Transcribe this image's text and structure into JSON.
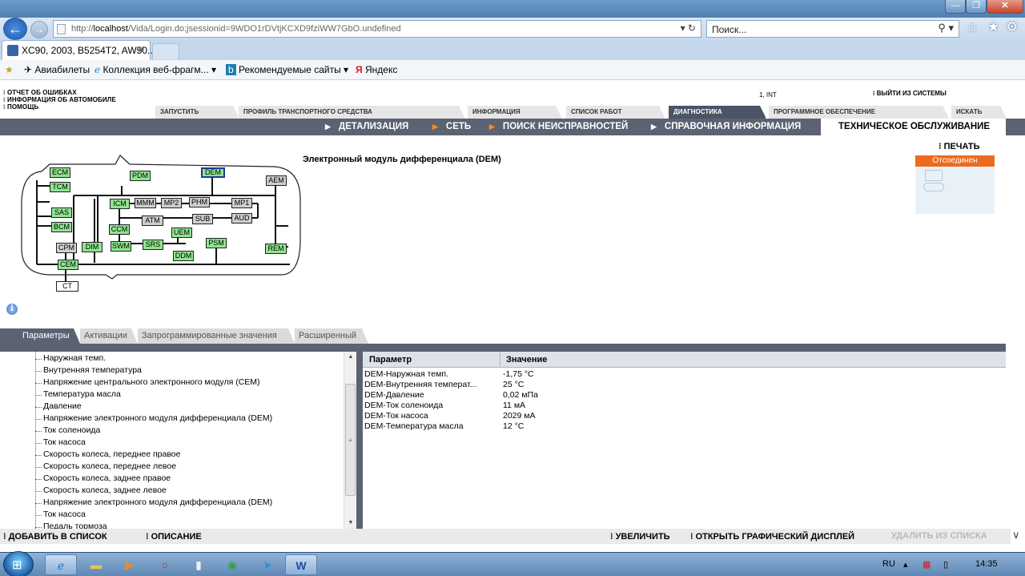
{
  "browser": {
    "url_prefix": "http://",
    "url_host": "localhost",
    "url_path": "/Vida/Login.do;jsessionid=9WDO1rDVtjKCXD9fziWW7GbO.undefined",
    "search_placeholder": "Поиск...",
    "tab_title": "XC90, 2003, B5254T2, AW50...",
    "favorites": {
      "flights": "Авиабилеты",
      "webslices": "Коллекция веб-фрагм...",
      "suggested": "Рекомендуемые сайты",
      "yandex": "Яндекс"
    }
  },
  "app": {
    "side_links": [
      "ОТЧЕТ ОБ ОШИБКАХ",
      "ИНФОРМАЦИЯ ОБ АВТОМОБИЛЕ",
      "ПОМОЩЬ"
    ],
    "user": "1, INT",
    "logout": "ВЫЙТИ ИЗ СИСТЕМЫ",
    "main_tabs": [
      "ЗАПУСТИТЬ",
      "ПРОФИЛЬ ТРАНСПОРТНОГО СРЕДСТВА",
      "ИНФОРМАЦИЯ",
      "СПИСОК РАБОТ",
      "ДИАГНОСТИКА",
      "ПРОГРАММНОЕ ОБЕСПЕЧЕНИЕ",
      "ИСКАТЬ"
    ],
    "sub_nav": [
      "ДЕТАЛИЗАЦИЯ",
      "СЕТЬ",
      "ПОИСК НЕИСПРАВНОСТЕЙ",
      "СПРАВОЧНАЯ ИНФОРМАЦИЯ"
    ],
    "sub_nav_active": "ТЕХНИЧЕСКОЕ ОБСЛУЖИВАНИЕ",
    "print": "ПЕЧАТЬ",
    "connection_status": "Отсоединен",
    "module_title": "Электронный модуль дифференциала (DEM)"
  },
  "diagram": {
    "nodes": [
      "ECM",
      "TCM",
      "SAS",
      "BCM",
      "CPM",
      "CEM",
      "CT",
      "DIM",
      "PDM",
      "DEM",
      "AEM",
      "ICM",
      "MMM",
      "MP2",
      "PHM",
      "MP1",
      "ATM",
      "SUB",
      "AUD",
      "CCM",
      "SWM",
      "SRS",
      "UEM",
      "DDM",
      "PSM",
      "REM"
    ]
  },
  "lower_tabs": [
    "Параметры",
    "Активации",
    "Запрограммированные значения",
    "Расширенный"
  ],
  "tree_items": [
    "Наружная темп.",
    "Внутренняя температура",
    "Напряжение центрального электронного модуля (CEM)",
    "Температура масла",
    "Давление",
    "Напряжение электронного модуля дифференциала (DEM)",
    "Ток соленоида",
    "Ток насоса",
    "Скорость колеса, переднее правое",
    "Скорость колеса, переднее левое",
    "Скорость колеса, заднее правое",
    "Скорость колеса, заднее левое",
    "Напряжение электронного модуля дифференциала (DEM)",
    "Ток насоса",
    "Педаль тормоза"
  ],
  "table": {
    "headers": [
      "Параметр",
      "Значение"
    ],
    "rows": [
      [
        "DEM-Наружная темп.",
        "-1,75 °C"
      ],
      [
        "DEM-Внутренняя температ...",
        "25 °C"
      ],
      [
        "DEM-Давление",
        "0,02 мПа"
      ],
      [
        "DEM-Ток соленоида",
        "11 мА"
      ],
      [
        "DEM-Ток насоса",
        "2029 мА"
      ],
      [
        "DEM-Температура масла",
        "12 °C"
      ]
    ]
  },
  "actions": {
    "add_to_list": "ДОБАВИТЬ В СПИСОК",
    "description": "ОПИСАНИЕ",
    "zoom": "УВЕЛИЧИТЬ",
    "open_graph": "ОТКРЫТЬ ГРАФИЧЕСКИЙ ДИСПЛЕЙ",
    "remove_from_list": "УДАЛИТЬ ИЗ СПИСКА"
  },
  "taskbar": {
    "language": "RU",
    "time": "14:35"
  },
  "colors": {
    "accent_orange": "#ee6a1f",
    "nav_dark": "#5b6272",
    "module_green": "#8fe58f"
  }
}
